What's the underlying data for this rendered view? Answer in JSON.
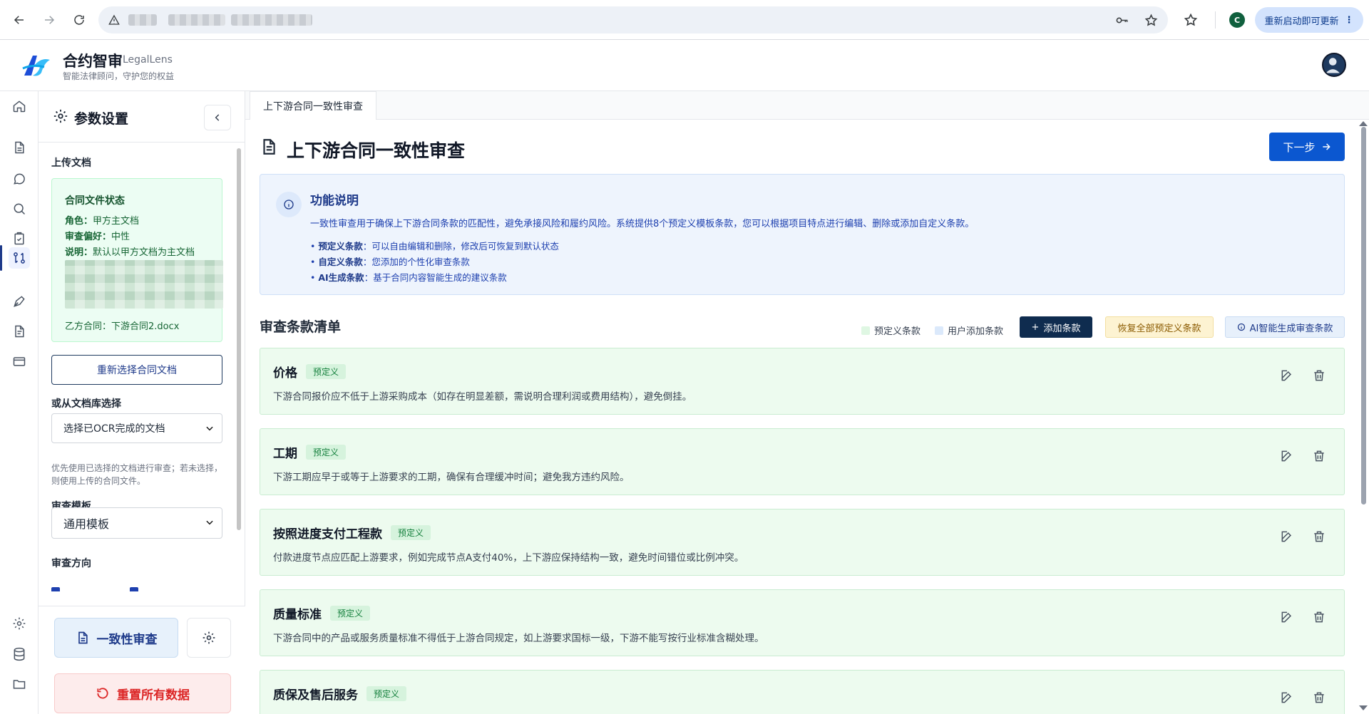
{
  "browser": {
    "update_label": "重新启动即可更新",
    "profile_initial": "C"
  },
  "brand": {
    "name": "合约智审",
    "name_en": "LegalLens",
    "tagline": "智能法律顾问，守护您的权益"
  },
  "rail": {
    "icons": [
      "home-icon",
      "document-icon",
      "chat-icon",
      "search-icon",
      "clipboard-check-icon",
      "compare-icon",
      "pen-icon",
      "file-text-icon",
      "card-icon",
      "settings-icon",
      "database-icon",
      "folder-icon"
    ]
  },
  "panel": {
    "title": "参数设置",
    "upload_label": "上传文档",
    "status": {
      "title": "合同文件状态",
      "role_key": "角色：",
      "role_val": "甲方主文档",
      "pref_key": "审查偏好：",
      "pref_val": "中性",
      "note_key": "说明：",
      "note_val": "默认以甲方文档为主文档",
      "party_b": "乙方合同：下游合同2.docx"
    },
    "reselect_label": "重新选择合同文档",
    "library_label": "或从文档库选择",
    "library_select": "选择已OCR完成的文档",
    "library_hint": "优先使用已选择的文档进行审查；若未选择，则使用上传的合同文件。",
    "template_label": "审查模板",
    "template_select": "通用模板",
    "direction_label": "审查方向",
    "consistency_label": "一致性审查",
    "reset_label": "重置所有数据"
  },
  "tabs": [
    {
      "label": "上下游合同一致性审查"
    }
  ],
  "main": {
    "title": "上下游合同一致性审查",
    "next_label": "下一步",
    "info": {
      "title": "功能说明",
      "desc": "一致性审查用于确保上下游合同条款的匹配性，避免承接风险和履约风险。系统提供8个预定义模板条款，您可以根据项目特点进行编辑、删除或添加自定义条款。",
      "bullets": [
        {
          "key": "预定义条款",
          "text": "：可以自由编辑和删除，修改后可恢复到默认状态"
        },
        {
          "key": "自定义条款",
          "text": "：您添加的个性化审查条款"
        },
        {
          "key": "AI生成条款",
          "text": "：基于合同内容智能生成的建议条款"
        }
      ]
    },
    "list_title": "审查条款清单",
    "legend": [
      {
        "label": "预定义条款",
        "color": "#dff7e3"
      },
      {
        "label": "用户添加条款",
        "color": "#dbe9fb"
      }
    ],
    "add_label": "添加条款",
    "restore_label": "恢复全部预定义条款",
    "ai_label": "AI智能生成审查条款",
    "clauses": [
      {
        "name": "价格",
        "tag": "预定义",
        "desc": "下游合同报价应不低于上游采购成本（如存在明显差额，需说明合理利润或费用结构），避免倒挂。"
      },
      {
        "name": "工期",
        "tag": "预定义",
        "desc": "下游工期应早于或等于上游要求的工期，确保有合理缓冲时间；避免我方违约风险。"
      },
      {
        "name": "按照进度支付工程款",
        "tag": "预定义",
        "desc": "付款进度节点应匹配上游要求，例如完成节点A支付40%，上下游应保持结构一致，避免时间错位或比例冲突。"
      },
      {
        "name": "质量标准",
        "tag": "预定义",
        "desc": "下游合同中的产品或服务质量标准不得低于上游合同规定，如上游要求国标一级，下游不能写按行业标准含糊处理。"
      },
      {
        "name": "质保及售后服务",
        "tag": "预定义",
        "desc": ""
      }
    ]
  },
  "colors": {
    "primary": "#0b57d0",
    "navy": "#0f2c4f",
    "predefined_bg": "#edfbef",
    "danger": "#dc2626"
  }
}
